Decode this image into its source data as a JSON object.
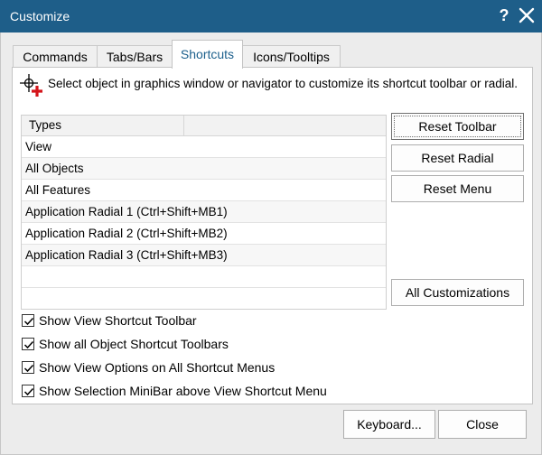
{
  "window": {
    "title": "Customize",
    "help_label": "?"
  },
  "tabs": [
    {
      "label": "Commands"
    },
    {
      "label": "Tabs/Bars"
    },
    {
      "label": "Shortcuts"
    },
    {
      "label": "Icons/Tooltips"
    }
  ],
  "active_tab": "Shortcuts",
  "hint": "Select object in graphics window or navigator to customize its shortcut toolbar or radial.",
  "types_list": {
    "header": "Types",
    "rows": [
      "View",
      "All Objects",
      "All Features",
      "Application Radial 1 (Ctrl+Shift+MB1)",
      "Application Radial 2 (Ctrl+Shift+MB2)",
      "Application Radial 3 (Ctrl+Shift+MB3)"
    ]
  },
  "buttons": {
    "reset_toolbar": "Reset Toolbar",
    "reset_radial": "Reset Radial",
    "reset_menu": "Reset Menu",
    "all_customizations": "All Customizations",
    "keyboard": "Keyboard...",
    "close": "Close"
  },
  "checkboxes": [
    {
      "label": "Show View Shortcut Toolbar",
      "checked": true
    },
    {
      "label": "Show all Object Shortcut Toolbars",
      "checked": true
    },
    {
      "label": "Show View Options on All Shortcut Menus",
      "checked": true
    },
    {
      "label": "Show Selection MiniBar above View Shortcut Menu",
      "checked": true
    }
  ],
  "colors": {
    "titlebar": "#1e5e89",
    "active_tab_text": "#1b5f8c",
    "icon_plus": "#d4141a"
  }
}
